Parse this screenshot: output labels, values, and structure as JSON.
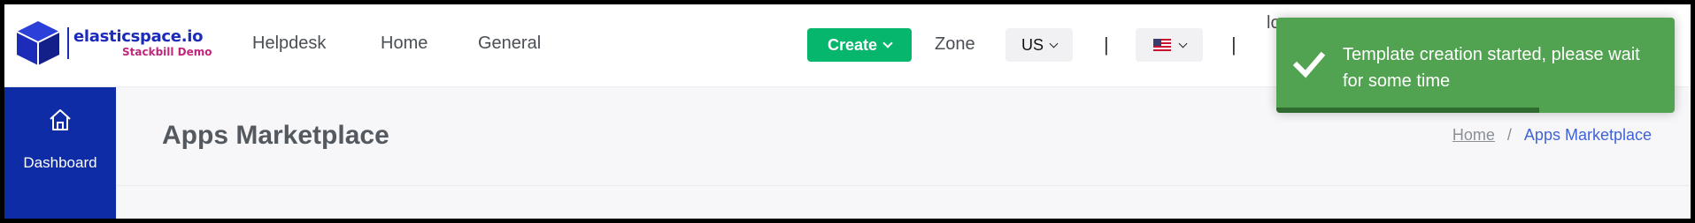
{
  "brand": {
    "name": "elasticspace.io",
    "subtitle": "Stackbill Demo",
    "cube_color": "#1c2bb8"
  },
  "nav": {
    "items": [
      "Helpdesk",
      "Home",
      "General"
    ]
  },
  "header": {
    "create_label": "Create",
    "zone_label": "Zone",
    "zone_value": "US",
    "separator": "|",
    "flag_icon": "us-flag-icon",
    "partial_text": "lo"
  },
  "sidebar": {
    "items": [
      {
        "label": "Dashboard",
        "icon": "home-icon"
      }
    ]
  },
  "page": {
    "title": "Apps Marketplace",
    "breadcrumb": {
      "home": "Home",
      "separator": "/",
      "current": "Apps Marketplace"
    }
  },
  "toast": {
    "message": "Template creation started, please wait for some time",
    "icon": "check-icon",
    "progress": 0.66,
    "color": "#51a351"
  },
  "colors": {
    "accent_green": "#06b66c",
    "sidebar_blue": "#0d2ca6",
    "link_blue": "#3f63d6"
  }
}
